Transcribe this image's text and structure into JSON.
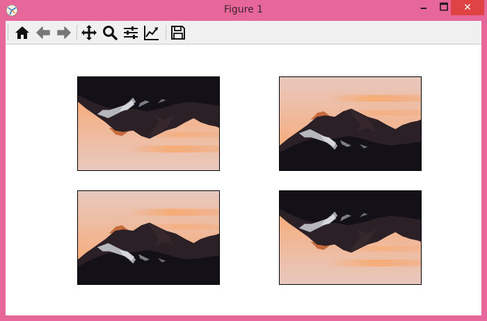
{
  "window": {
    "title": "Figure 1",
    "controls": {
      "minimize": "🗕",
      "maximize": "🗖",
      "close": "✕"
    }
  },
  "toolbar": {
    "tools": [
      "home-icon",
      "back-arrow-icon",
      "forward-arrow-icon",
      "pan-move-icon",
      "zoom-magnifier-icon",
      "configure-subplots-icon",
      "edit-axes-icon",
      "save-floppy-icon"
    ]
  },
  "figure": {
    "subplots": [
      {
        "position": "top-left",
        "image": "mountain-sunset-flipped-vertical"
      },
      {
        "position": "top-right",
        "image": "mountain-sunset"
      },
      {
        "position": "bottom-left",
        "image": "mountain-sunset"
      },
      {
        "position": "bottom-right",
        "image": "mountain-sunset-flipped-vertical"
      }
    ]
  },
  "colors": {
    "frame": "#e8679a",
    "close_button": "#e04343",
    "toolbar_bg": "#f0f0f0",
    "sky_top": "#e6c7bd",
    "sky_bottom": "#f6a972",
    "mountain_dark": "#141018"
  }
}
